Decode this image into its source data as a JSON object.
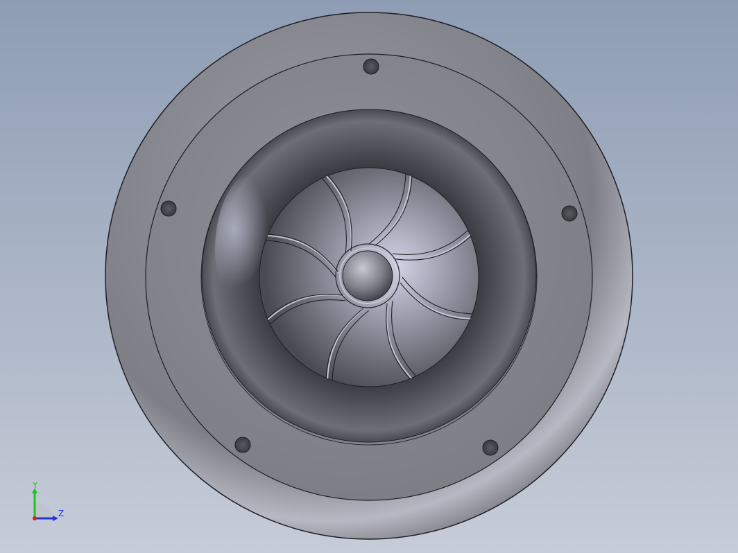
{
  "viewport": {
    "background_top": "#8e9db4",
    "background_bottom": "#c6ccd8"
  },
  "model": {
    "part": "centrifugal-fan-impeller-with-inlet-housing",
    "body_color": "#8a8b93",
    "edge_color": "#1e1e22",
    "highlight_color": "#c8cad6",
    "blade_count": 8,
    "bolt_hole_count": 5
  },
  "triad": {
    "y_label": "Y",
    "z_label": "Z",
    "y_color": "#22c022",
    "z_color": "#2233dd",
    "x_color": "#cc2222",
    "icon": "view-orientation-triad-icon"
  }
}
